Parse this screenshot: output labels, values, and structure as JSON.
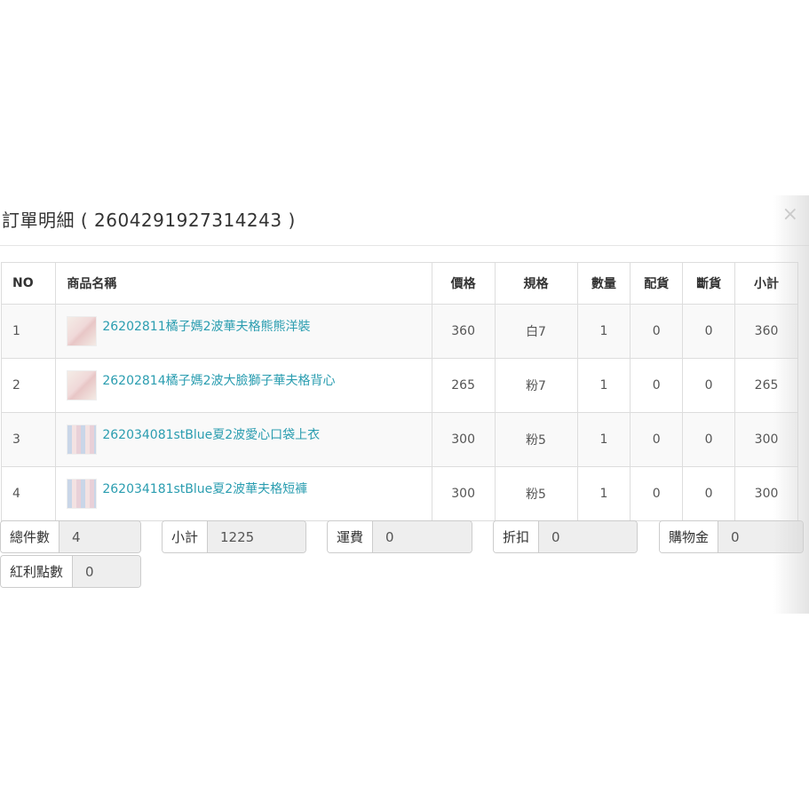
{
  "modal": {
    "title": "訂單明細 ( 2604291927314243 )",
    "close_glyph": "×"
  },
  "table": {
    "headers": [
      "NO",
      "商品名稱",
      "價格",
      "規格",
      "數量",
      "配貨",
      "斷貨",
      "小計"
    ],
    "rows": [
      {
        "no": "1",
        "name": "26202811橘子媽2波華夫格熊熊洋裝",
        "price": "360",
        "spec": "白7",
        "qty": "1",
        "alloc": "0",
        "out": "0",
        "subtotal": "360",
        "thumb": "photo"
      },
      {
        "no": "2",
        "name": "26202814橘子媽2波大臉獅子華夫格背心",
        "price": "265",
        "spec": "粉7",
        "qty": "1",
        "alloc": "0",
        "out": "0",
        "subtotal": "265",
        "thumb": "photo"
      },
      {
        "no": "3",
        "name": "262034081stBlue夏2波愛心口袋上衣",
        "price": "300",
        "spec": "粉5",
        "qty": "1",
        "alloc": "0",
        "out": "0",
        "subtotal": "300",
        "thumb": "photo"
      },
      {
        "no": "4",
        "name": "262034181stBlue夏2波華夫格短褲",
        "price": "300",
        "spec": "粉5",
        "qty": "1",
        "alloc": "0",
        "out": "0",
        "subtotal": "300",
        "thumb": "photo"
      }
    ]
  },
  "summary": {
    "total_items": {
      "label": "總件數",
      "value": "4"
    },
    "subtotal": {
      "label": "小計",
      "value": "1225"
    },
    "shipping": {
      "label": "運費",
      "value": "0"
    },
    "discount": {
      "label": "折扣",
      "value": "0"
    },
    "shopping_credit": {
      "label": "購物金",
      "value": "0"
    },
    "bonus_points": {
      "label": "紅利點數",
      "value": "0"
    }
  },
  "colors": {
    "link": "#2a9db0",
    "stripe": "#f9f9f9",
    "readonly_bg": "#eeeeee",
    "border": "#dddddd"
  }
}
